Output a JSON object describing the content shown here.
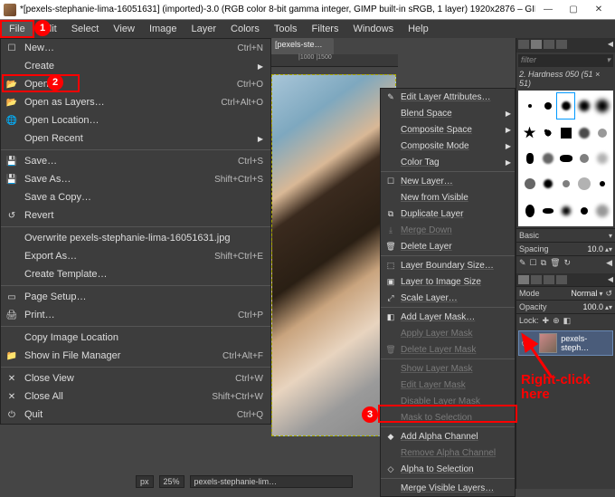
{
  "title": "*[pexels-stephanie-lima-16051631] (imported)-3.0 (RGB color 8-bit gamma integer, GIMP built-in sRGB, 1 layer) 1920x2876 – GIMP",
  "menubar": [
    "File",
    "Edit",
    "Select",
    "View",
    "Image",
    "Layer",
    "Colors",
    "Tools",
    "Filters",
    "Windows",
    "Help"
  ],
  "annotations": {
    "step1": "1",
    "step2": "2",
    "step3": "3",
    "rightclick_line1": "Right-click",
    "rightclick_line2": "here"
  },
  "ruler": "|1000            |1500",
  "tab_label": "[pexels-ste…",
  "file_menu": [
    {
      "icon": "☐",
      "label": "New…",
      "short": "Ctrl+N"
    },
    {
      "icon": "",
      "label": "Create",
      "arrow": true
    },
    {
      "icon": "📂",
      "label": "Open…",
      "short": "Ctrl+O"
    },
    {
      "icon": "📂",
      "label": "Open as Layers…",
      "short": "Ctrl+Alt+O"
    },
    {
      "icon": "🌐",
      "label": "Open Location…"
    },
    {
      "icon": "",
      "label": "Open Recent",
      "arrow": true
    },
    {
      "sep": true
    },
    {
      "icon": "💾",
      "label": "Save…",
      "short": "Ctrl+S"
    },
    {
      "icon": "💾",
      "label": "Save As…",
      "short": "Shift+Ctrl+S"
    },
    {
      "icon": "",
      "label": "Save a Copy…"
    },
    {
      "icon": "↺",
      "label": "Revert"
    },
    {
      "sep": true
    },
    {
      "icon": "",
      "label": "Overwrite pexels-stephanie-lima-16051631.jpg"
    },
    {
      "icon": "",
      "label": "Export As…",
      "short": "Shift+Ctrl+E"
    },
    {
      "icon": "",
      "label": "Create Template…"
    },
    {
      "sep": true
    },
    {
      "icon": "▭",
      "label": "Page Setup…"
    },
    {
      "icon": "🖨",
      "label": "Print…",
      "short": "Ctrl+P"
    },
    {
      "sep": true
    },
    {
      "icon": "",
      "label": "Copy Image Location"
    },
    {
      "icon": "📁",
      "label": "Show in File Manager",
      "short": "Ctrl+Alt+F"
    },
    {
      "sep": true
    },
    {
      "icon": "✕",
      "label": "Close View",
      "short": "Ctrl+W"
    },
    {
      "icon": "✕",
      "label": "Close All",
      "short": "Shift+Ctrl+W"
    },
    {
      "icon": "⏻",
      "label": "Quit",
      "short": "Ctrl+Q"
    }
  ],
  "layer_menu": [
    {
      "icon": "✎",
      "label": "Edit Layer Attributes…"
    },
    {
      "label": "Blend Space",
      "arrow": true
    },
    {
      "label": "Composite Space",
      "arrow": true
    },
    {
      "label": "Composite Mode",
      "arrow": true
    },
    {
      "label": "Color Tag",
      "arrow": true
    },
    {
      "sep": true
    },
    {
      "icon": "☐",
      "label": "New Layer…"
    },
    {
      "label": "New from Visible"
    },
    {
      "icon": "⧉",
      "label": "Duplicate Layer"
    },
    {
      "icon": "⤓",
      "label": "Merge Down",
      "dis": true
    },
    {
      "icon": "🗑",
      "label": "Delete Layer"
    },
    {
      "sep": true
    },
    {
      "icon": "⬚",
      "label": "Layer Boundary Size…"
    },
    {
      "icon": "▣",
      "label": "Layer to Image Size"
    },
    {
      "icon": "⤢",
      "label": "Scale Layer…"
    },
    {
      "sep": true
    },
    {
      "icon": "◧",
      "label": "Add Layer Mask…"
    },
    {
      "label": "Apply Layer Mask",
      "dis": true
    },
    {
      "icon": "🗑",
      "label": "Delete Layer Mask",
      "dis": true
    },
    {
      "sep": true
    },
    {
      "label": "Show Layer Mask",
      "dis": true
    },
    {
      "label": "Edit Layer Mask",
      "dis": true
    },
    {
      "label": "Disable Layer Mask",
      "dis": true
    },
    {
      "label": "Mask to Selection",
      "dis": true
    },
    {
      "sep": true
    },
    {
      "icon": "◆",
      "label": "Add Alpha Channel"
    },
    {
      "label": "Remove Alpha Channel",
      "dis": true
    },
    {
      "icon": "◇",
      "label": "Alpha to Selection"
    },
    {
      "sep": true
    },
    {
      "label": "Merge Visible Layers…"
    }
  ],
  "right_panel": {
    "filter": "filter",
    "brush_name": "2. Hardness 050 (51 × 51)",
    "basic": "Basic",
    "spacing_label": "Spacing",
    "spacing_val": "10.0",
    "mode_label": "Mode",
    "mode_val": "Normal",
    "opacity_label": "Opacity",
    "opacity_val": "100.0",
    "lock_label": "Lock:",
    "layer_name": "pexels-steph…"
  },
  "status": {
    "px": "px",
    "pct": "25%",
    "name": "pexels-stephanie-lim…"
  }
}
